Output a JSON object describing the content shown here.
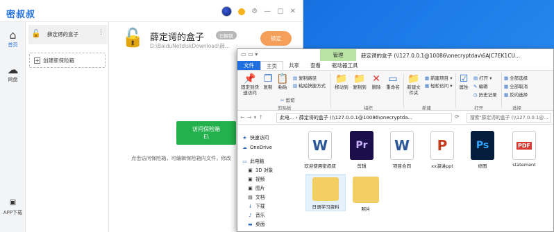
{
  "app": {
    "title": "密叔叔",
    "rail": [
      {
        "label": "首页",
        "icon": "home-icon"
      },
      {
        "label": "网盘",
        "icon": "cloud-icon"
      },
      {
        "label": "APP下载",
        "icon": "app-download-icon"
      }
    ],
    "vault_item": {
      "name": "薛定谔的盒子"
    },
    "create_label": "创建新保险箱",
    "detail": {
      "title": "薛定谔的盒子",
      "badge": "已解锁",
      "path": "D:\\BaiduNetdiskDownload\\薛...",
      "lock_label": "锁定",
      "visit_label": "访问保险箱",
      "visit_drive": "E\\",
      "hint": "点击访问保险箱，可编辑保险箱内文件，修改"
    }
  },
  "explorer": {
    "manage_tab": "管理",
    "title": "薛定谔的盒子 (\\\\127.0.0.1@10086\\onecryptdav\\6AJC7EK1CU...",
    "tabs": [
      "文件",
      "主页",
      "共享",
      "查看",
      "驱动器工具"
    ],
    "ribbon": {
      "pin": "固定到快速访问",
      "copy": "复制",
      "paste": "粘贴",
      "copy_path": "复制路径",
      "paste_shortcut": "粘贴快捷方式",
      "cut": "剪切",
      "move_to": "移动到",
      "copy_to": "复制到",
      "delete": "删除",
      "rename": "重命名",
      "new_folder": "新建文件夹",
      "new_item": "新建项目",
      "easy_access": "轻松访问",
      "properties": "属性",
      "open": "打开",
      "edit": "编辑",
      "history": "历史记录",
      "select_all": "全部选择",
      "select_none": "全部取消",
      "invert": "反向选择",
      "groups": [
        "剪贴板",
        "组织",
        "新建",
        "打开",
        "选择"
      ]
    },
    "address": "此电... › 薛定谔的盒子 (\\\\127.0.0.1@10086\\onecryptda...",
    "search_placeholder": "搜索\"薛定谔的盒子 (\\\\127.0.0.1@...",
    "nav": [
      "快速访问",
      "OneDrive",
      "此电脑",
      "3D 对象",
      "视频",
      "图片",
      "文档",
      "下载",
      "音乐",
      "桌面"
    ],
    "files": [
      {
        "name": "欢迎使用密叔叔",
        "type": "word",
        "color": "#2b579a",
        "label": "W"
      },
      {
        "name": "剪辑",
        "type": "premiere",
        "color": "#1b0f4a",
        "label": "Pr"
      },
      {
        "name": "项目合同",
        "type": "word",
        "color": "#2b579a",
        "label": "W"
      },
      {
        "name": "xx演讲ppt",
        "type": "powerpoint",
        "color": "#c43e1c",
        "label": "P"
      },
      {
        "name": "修图",
        "type": "photoshop",
        "color": "#061e3d",
        "label": "Ps"
      },
      {
        "name": "statement",
        "type": "pdf",
        "color": "#d63a30",
        "label": "PDF"
      },
      {
        "name": "日语学习资料",
        "type": "folder",
        "color": "#f3cf63",
        "label": ""
      },
      {
        "name": "照片",
        "type": "folder",
        "color": "#f3cf63",
        "label": ""
      }
    ]
  }
}
